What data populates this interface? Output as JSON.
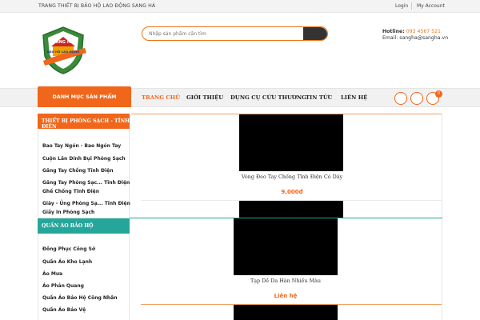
{
  "topbar": {
    "company": "TRANG THIẾT BỊ BẢO HỘ LAO ĐỘNG SANG HÀ",
    "login": "Login",
    "account": "My Account"
  },
  "header": {
    "logo_text_top": "SANG HÀ",
    "logo_text_bottom": "BẢO HỘ LAO ĐỘNG",
    "search_placeholder": "Nhập sản phẩm cần tìm",
    "hotline_label": "Hotline:",
    "hotline_number": "093 4567 521",
    "email_label": "Email:",
    "email_value": "sangha@sangha.vn"
  },
  "nav": {
    "category_button": "DANH MỤC SẢN PHẨM",
    "items": [
      "TRANG CHỦ",
      "GIỚI THIỆU",
      "DỤNG CỤ CỨU THƯƠNG",
      "TIN TỨC",
      "LIÊN HỆ"
    ],
    "cart_count": "0"
  },
  "sidebar": {
    "section1_title": "THIẾT BỊ PHÒNG SẠCH - TĨNH ĐIỆN",
    "section1_items": [
      "Bao Tay Ngón - Bao Ngón Tay",
      "Cuộn Lăn Dính Bụi Phòng Sạch",
      "Găng Tay Chống Tĩnh Điện",
      "Găng Tay Phòng Sạc... Tĩnh Điện",
      "Ghế Chống Tĩnh Điện",
      "Giày - Ủng Phòng Sạ... Tĩnh Điện",
      "Giấy In Phòng Sạch"
    ],
    "section2_title": "QUẦN ÁO BẢO HỘ",
    "section2_items": [
      "Đồng Phục Công Sở",
      "Quần Áo Kho Lạnh",
      "Áo Mưa",
      "Áo Phản Quang",
      "Quần Áo Bảo Hộ Công Nhân",
      "Quần Áo Bảo Vệ"
    ]
  },
  "products": [
    {
      "name": "Vòng Đeo Tay Chống Tĩnh Điện Có Dây",
      "price": "9,000đ"
    },
    {
      "name": "Tạp Dề Da Hàn Nhiều Màu",
      "price": "Liên hệ"
    }
  ],
  "colors": {
    "accent": "#f0661a",
    "teal": "#26a69a",
    "dark": "#333333"
  }
}
